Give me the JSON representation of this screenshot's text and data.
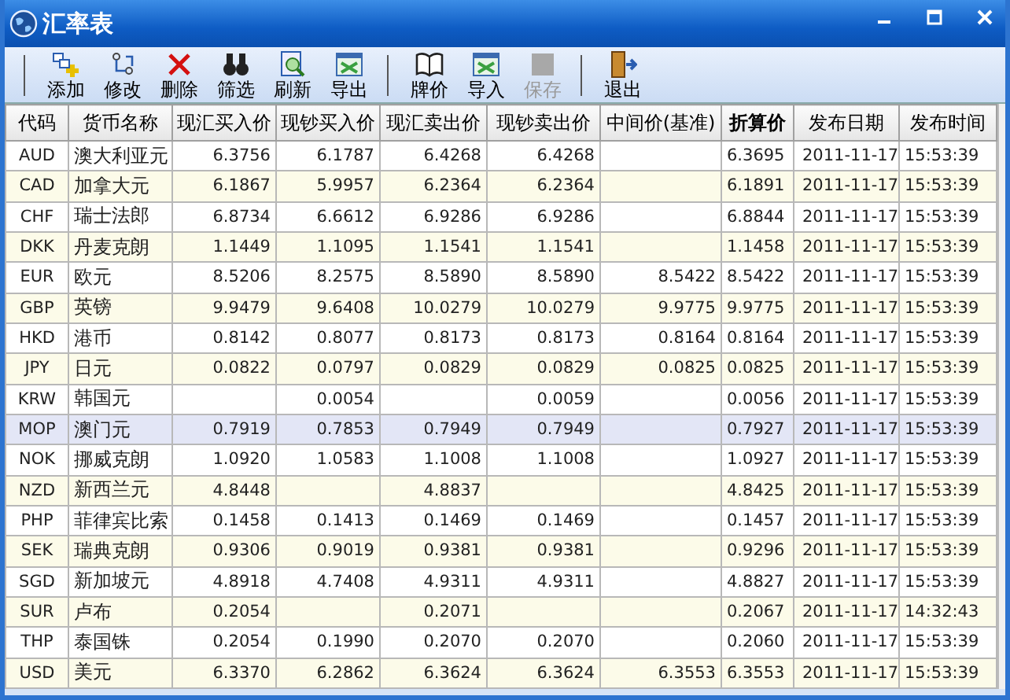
{
  "window": {
    "title": "汇率表"
  },
  "toolbar": [
    {
      "kind": "separator"
    },
    {
      "kind": "button",
      "label": "添加",
      "disabled": false
    },
    {
      "kind": "button",
      "label": "修改",
      "disabled": false
    },
    {
      "kind": "button",
      "label": "删除",
      "disabled": false
    },
    {
      "kind": "button",
      "label": "筛选",
      "disabled": false
    },
    {
      "kind": "button",
      "label": "刷新",
      "disabled": false
    },
    {
      "kind": "button",
      "label": "导出",
      "disabled": false
    },
    {
      "kind": "separator"
    },
    {
      "kind": "button",
      "label": "牌价",
      "disabled": false
    },
    {
      "kind": "button",
      "label": "导入",
      "disabled": false
    },
    {
      "kind": "button",
      "label": "保存",
      "disabled": true
    },
    {
      "kind": "separator"
    },
    {
      "kind": "button",
      "label": "退出",
      "disabled": false
    }
  ],
  "table": {
    "columns": [
      {
        "label": "代码",
        "bold": false
      },
      {
        "label": "货币名称",
        "bold": false
      },
      {
        "label": "现汇买入价",
        "bold": false
      },
      {
        "label": "现钞买入价",
        "bold": false
      },
      {
        "label": "现汇卖出价",
        "bold": false
      },
      {
        "label": "现钞卖出价",
        "bold": false
      },
      {
        "label": "中间价(基准)",
        "bold": false
      },
      {
        "label": "折算价",
        "bold": true
      },
      {
        "label": "发布日期",
        "bold": false
      },
      {
        "label": "发布时间",
        "bold": false
      }
    ],
    "rows": [
      {
        "selected": false,
        "cells": [
          "AUD",
          "澳大利亚元",
          "6.3756",
          "6.1787",
          "6.4268",
          "6.4268",
          null,
          "6.3695",
          "2011-11-17",
          "15:53:39"
        ]
      },
      {
        "selected": false,
        "cells": [
          "CAD",
          "加拿大元",
          "6.1867",
          "5.9957",
          "6.2364",
          "6.2364",
          null,
          "6.1891",
          "2011-11-17",
          "15:53:39"
        ]
      },
      {
        "selected": false,
        "cells": [
          "CHF",
          "瑞士法郎",
          "6.8734",
          "6.6612",
          "6.9286",
          "6.9286",
          null,
          "6.8844",
          "2011-11-17",
          "15:53:39"
        ]
      },
      {
        "selected": false,
        "cells": [
          "DKK",
          "丹麦克朗",
          "1.1449",
          "1.1095",
          "1.1541",
          "1.1541",
          null,
          "1.1458",
          "2011-11-17",
          "15:53:39"
        ]
      },
      {
        "selected": false,
        "cells": [
          "EUR",
          "欧元",
          "8.5206",
          "8.2575",
          "8.5890",
          "8.5890",
          "8.5422",
          "8.5422",
          "2011-11-17",
          "15:53:39"
        ]
      },
      {
        "selected": false,
        "cells": [
          "GBP",
          "英镑",
          "9.9479",
          "9.6408",
          "10.0279",
          "10.0279",
          "9.9775",
          "9.9775",
          "2011-11-17",
          "15:53:39"
        ]
      },
      {
        "selected": false,
        "cells": [
          "HKD",
          "港币",
          "0.8142",
          "0.8077",
          "0.8173",
          "0.8173",
          "0.8164",
          "0.8164",
          "2011-11-17",
          "15:53:39"
        ]
      },
      {
        "selected": false,
        "cells": [
          "JPY",
          "日元",
          "0.0822",
          "0.0797",
          "0.0829",
          "0.0829",
          "0.0825",
          "0.0825",
          "2011-11-17",
          "15:53:39"
        ]
      },
      {
        "selected": false,
        "cells": [
          "KRW",
          "韩国元",
          null,
          "0.0054",
          null,
          "0.0059",
          null,
          "0.0056",
          "2011-11-17",
          "15:53:39"
        ]
      },
      {
        "selected": true,
        "cells": [
          "MOP",
          "澳门元",
          "0.7919",
          "0.7853",
          "0.7949",
          "0.7949",
          null,
          "0.7927",
          "2011-11-17",
          "15:53:39"
        ]
      },
      {
        "selected": false,
        "cells": [
          "NOK",
          "挪威克朗",
          "1.0920",
          "1.0583",
          "1.1008",
          "1.1008",
          null,
          "1.0927",
          "2011-11-17",
          "15:53:39"
        ]
      },
      {
        "selected": false,
        "cells": [
          "NZD",
          "新西兰元",
          "4.8448",
          null,
          "4.8837",
          null,
          null,
          "4.8425",
          "2011-11-17",
          "15:53:39"
        ]
      },
      {
        "selected": false,
        "cells": [
          "PHP",
          "菲律宾比索",
          "0.1458",
          "0.1413",
          "0.1469",
          "0.1469",
          null,
          "0.1457",
          "2011-11-17",
          "15:53:39"
        ]
      },
      {
        "selected": false,
        "cells": [
          "SEK",
          "瑞典克朗",
          "0.9306",
          "0.9019",
          "0.9381",
          "0.9381",
          null,
          "0.9296",
          "2011-11-17",
          "15:53:39"
        ]
      },
      {
        "selected": false,
        "cells": [
          "SGD",
          "新加坡元",
          "4.8918",
          "4.7408",
          "4.9311",
          "4.9311",
          null,
          "4.8827",
          "2011-11-17",
          "15:53:39"
        ]
      },
      {
        "selected": false,
        "cells": [
          "SUR",
          "卢布",
          "0.2054",
          null,
          "0.2071",
          null,
          null,
          "0.2067",
          "2011-11-17",
          "14:32:43"
        ]
      },
      {
        "selected": false,
        "cells": [
          "THP",
          "泰国铢",
          "0.2054",
          "0.1990",
          "0.2070",
          "0.2070",
          null,
          "0.2060",
          "2011-11-17",
          "15:53:39"
        ]
      },
      {
        "selected": false,
        "cells": [
          "USD",
          "美元",
          "6.3370",
          "6.2862",
          "6.3624",
          "6.3624",
          "6.3553",
          "6.3553",
          "2011-11-17",
          "15:53:39"
        ]
      }
    ]
  }
}
